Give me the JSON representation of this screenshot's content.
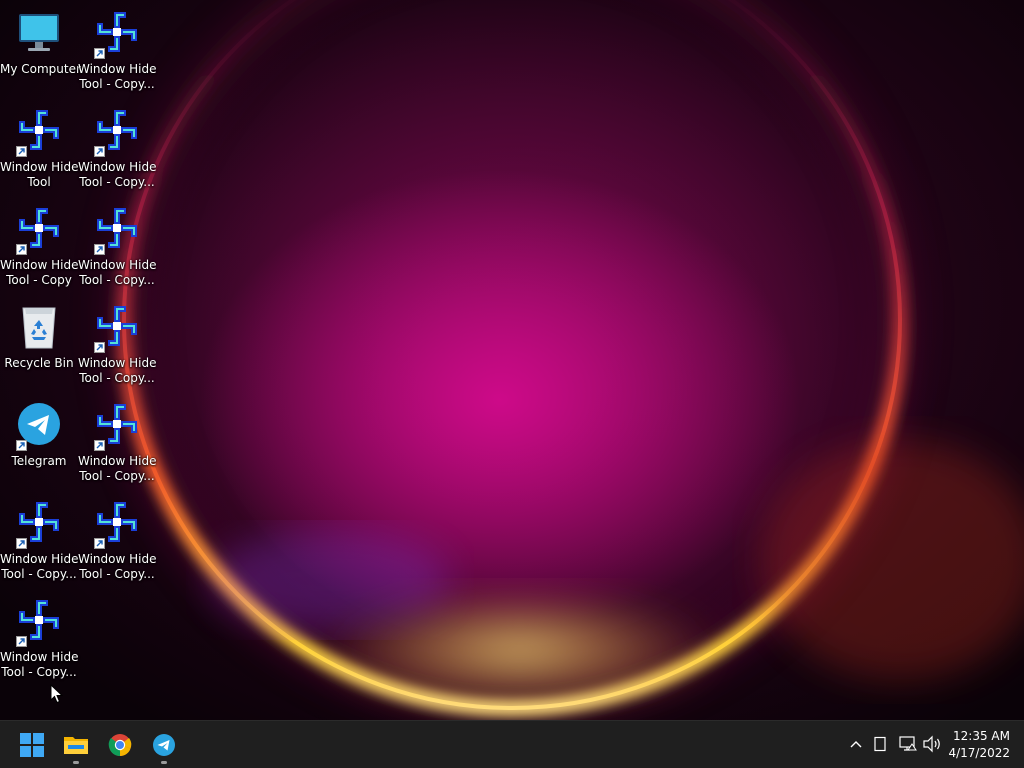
{
  "desktop": {
    "icons": [
      {
        "id": "my-computer",
        "line1": "My Computer",
        "line2": ""
      },
      {
        "id": "wht-copy-1",
        "line1": "Window Hide",
        "line2": "Tool - Copy..."
      },
      {
        "id": "wht",
        "line1": "Window Hide",
        "line2": "Tool"
      },
      {
        "id": "wht-copy-2",
        "line1": "Window Hide",
        "line2": "Tool - Copy..."
      },
      {
        "id": "wht-copy",
        "line1": "Window Hide",
        "line2": "Tool - Copy"
      },
      {
        "id": "wht-copy-3",
        "line1": "Window Hide",
        "line2": "Tool - Copy..."
      },
      {
        "id": "recycle-bin",
        "line1": "Recycle Bin",
        "line2": ""
      },
      {
        "id": "wht-copy-4",
        "line1": "Window Hide",
        "line2": "Tool - Copy..."
      },
      {
        "id": "telegram",
        "line1": "Telegram",
        "line2": ""
      },
      {
        "id": "wht-copy-5",
        "line1": "Window Hide",
        "line2": "Tool - Copy..."
      },
      {
        "id": "wht-copy-6",
        "line1": "Window Hide",
        "line2": "Tool - Copy..."
      },
      {
        "id": "wht-copy-7",
        "line1": "Window Hide",
        "line2": "Tool - Copy..."
      },
      {
        "id": "wht-copy-8",
        "line1": "Window Hide",
        "line2": "Tool - Copy..."
      }
    ]
  },
  "taskbar": {
    "pinned": [
      {
        "name": "start-button",
        "icon": "windows-logo-icon",
        "running": false
      },
      {
        "name": "file-explorer-button",
        "icon": "folder-icon",
        "running": true
      },
      {
        "name": "chrome-button",
        "icon": "chrome-icon",
        "running": false
      },
      {
        "name": "telegram-button",
        "icon": "telegram-icon",
        "running": true
      }
    ],
    "tray": {
      "icons": [
        "chevron-up-icon",
        "tablet-icon",
        "network-icon",
        "volume-icon"
      ],
      "time": "12:35 AM",
      "date": "4/17/2022"
    }
  },
  "colors": {
    "taskbar_bg": "#1f1f1f",
    "windows_blue": "#3fa9f5",
    "telegram_blue": "#2aa3e0",
    "wallpaper_magenta": "#c8108a",
    "wallpaper_orange": "#f36a2a",
    "wallpaper_yellow": "#ffd23a"
  }
}
